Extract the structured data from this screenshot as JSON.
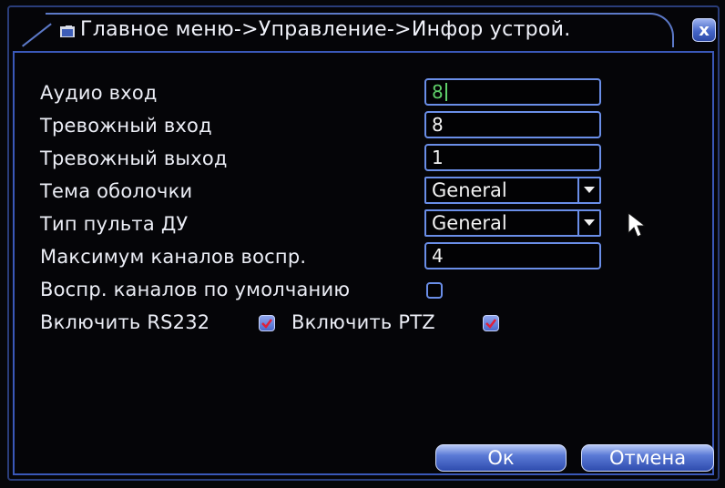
{
  "title": {
    "breadcrumb": "Главное меню->Управление->Инфор устрой.",
    "close_glyph": "x"
  },
  "form": {
    "audio_in": {
      "label": "Аудио вход",
      "value": "8"
    },
    "alarm_in": {
      "label": "Тревожный вход",
      "value": "8"
    },
    "alarm_out": {
      "label": "Тревожный выход",
      "value": "1"
    },
    "shell_theme": {
      "label": "Тема оболочки",
      "selected": "General"
    },
    "remote_type": {
      "label": "Тип пульта ДУ",
      "selected": "General"
    },
    "max_playback": {
      "label": "Максимум каналов воспр.",
      "value": "4"
    },
    "default_playback": {
      "label": "Воспр. каналов по умолчанию",
      "checked": false
    },
    "rs232": {
      "label": "Включить RS232",
      "checked": true
    },
    "ptz": {
      "label": "Включить PTZ",
      "checked": true
    }
  },
  "buttons": {
    "ok": "Ок",
    "cancel": "Отмена"
  },
  "colors": {
    "accent_border": "#6a8ee8",
    "active_text": "#5fd06a",
    "checkmark": "#e0203a"
  }
}
